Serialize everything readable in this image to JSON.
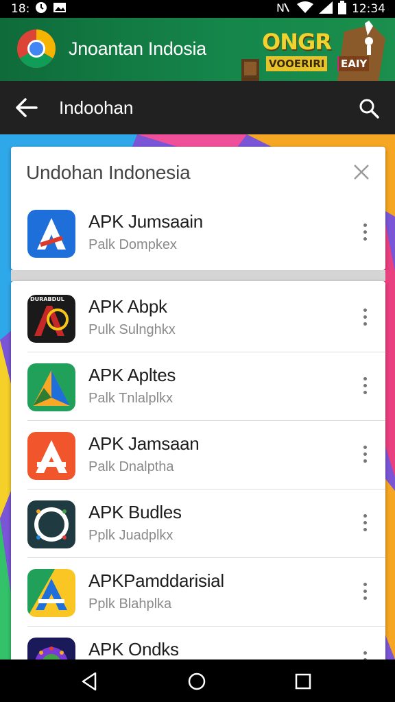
{
  "status_bar": {
    "time_left": "18:",
    "time_right": "12:34",
    "icons": [
      "alarm-icon",
      "image-icon",
      "nfc-icon",
      "wifi-icon",
      "signal-icon",
      "battery-icon"
    ]
  },
  "banner": {
    "title": "Jnoantan Indosia",
    "promo_big": "ONGR",
    "promo_small": "VOOERIRI",
    "promo_tag": "EAIY"
  },
  "toolbar": {
    "title": "Indoohan",
    "back_icon": "arrow-back-icon",
    "search_icon": "search-icon"
  },
  "featured": {
    "title": "Undohan Indonesia",
    "close_icon": "close-icon",
    "app": {
      "name": "APK Jumsaain",
      "subtitle": "Palk Dompkex",
      "icon": "apk-a-blue-icon"
    }
  },
  "apps": [
    {
      "name": "APK Abpk",
      "subtitle": "Pulk Sulnghkx",
      "icon": "apk-a-dark-icon",
      "icon_text": "DURABDUL"
    },
    {
      "name": "APK Apltes",
      "subtitle": "Palk Tnlalplkx",
      "icon": "apk-triangle-green-icon"
    },
    {
      "name": "APK Jamsaan",
      "subtitle": "Palk Dnalptha",
      "icon": "apk-a-orange-icon"
    },
    {
      "name": "APK Budles",
      "subtitle": "Pplk Juadplkx",
      "icon": "apk-gear-dark-icon"
    },
    {
      "name": "APKPamddarisial",
      "subtitle": "Pplk Blahplka",
      "icon": "apk-a-yellow-icon"
    },
    {
      "name": "APK Ondks",
      "subtitle": "",
      "icon": "apk-gear-purple-icon"
    }
  ],
  "nav": {
    "back": "nav-back-icon",
    "home": "nav-home-icon",
    "recents": "nav-recents-icon"
  },
  "colors": {
    "banner_green": "#15854a",
    "toolbar": "#212121",
    "promo_yellow": "#f0d330"
  }
}
